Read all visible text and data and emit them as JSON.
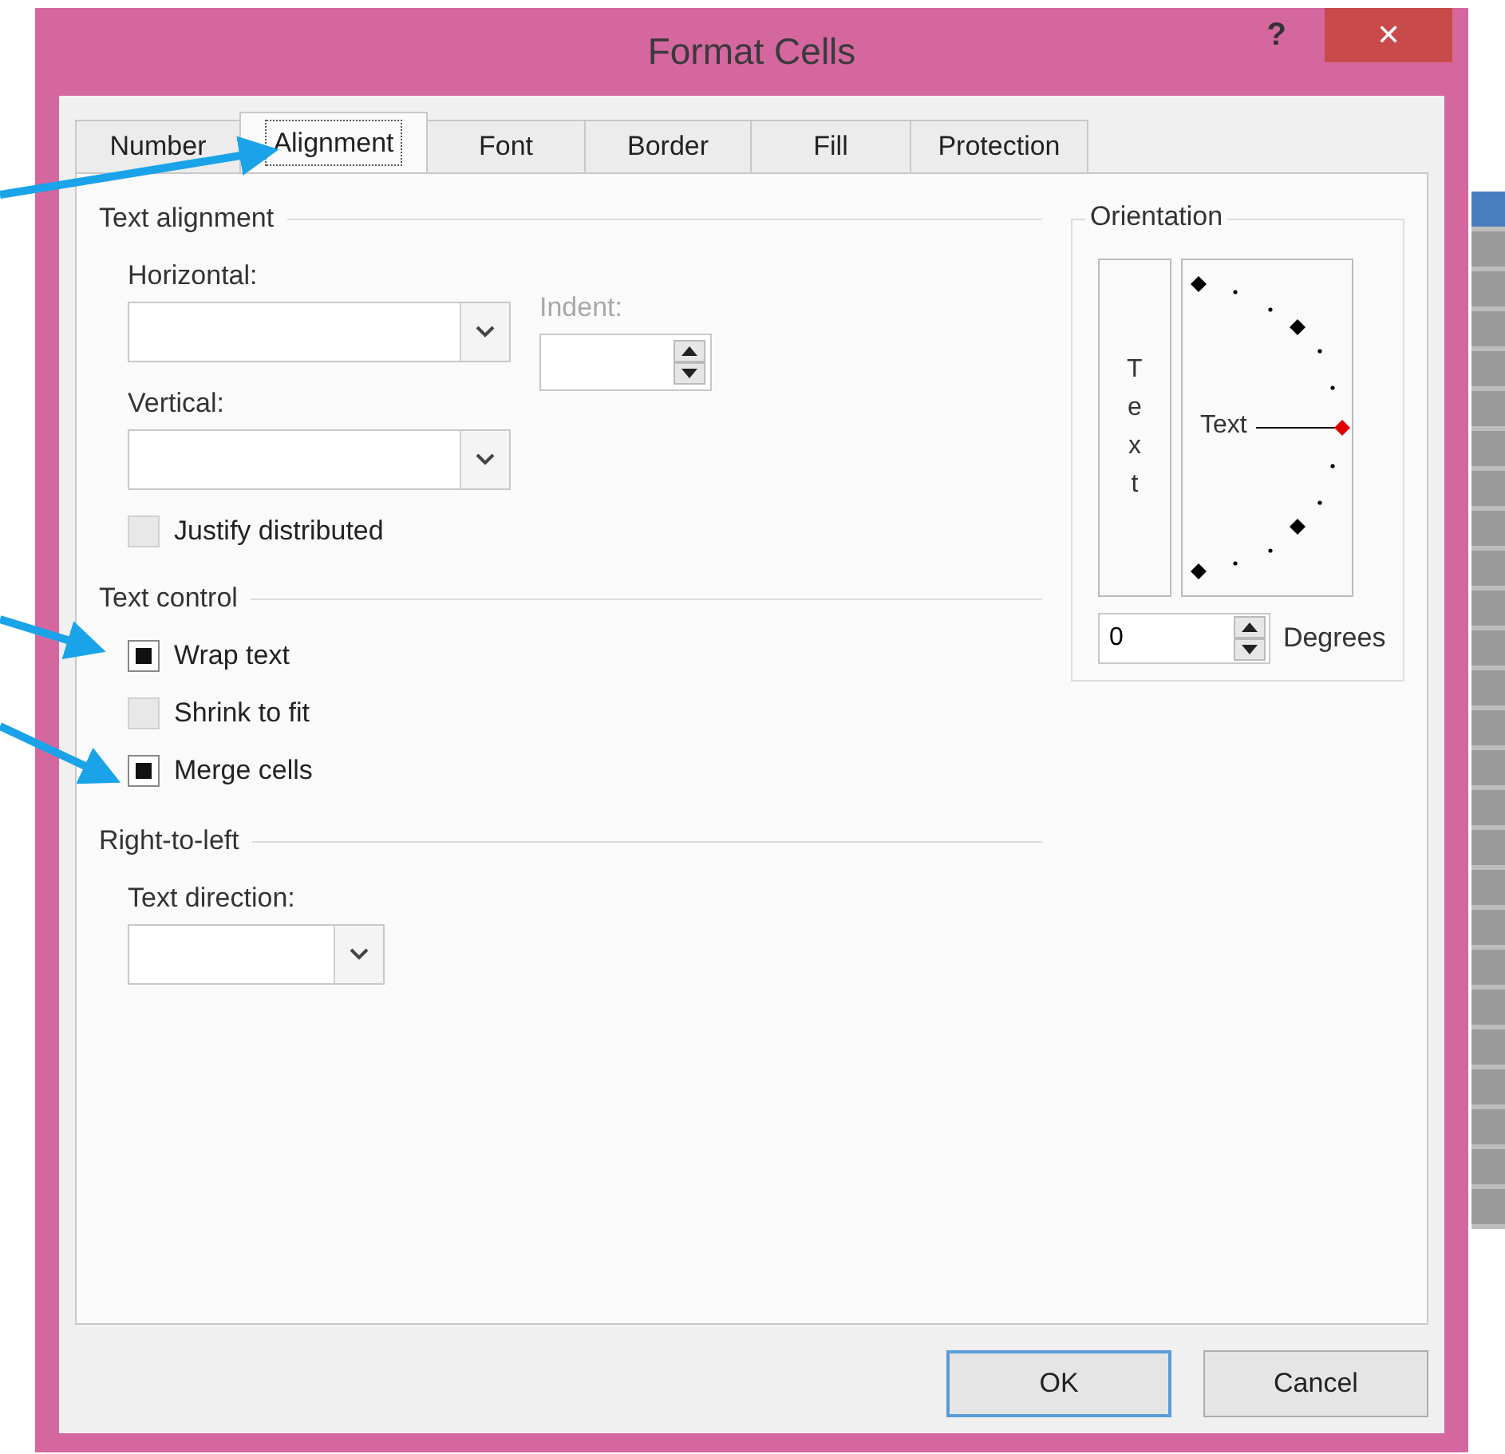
{
  "window": {
    "title": "Format Cells",
    "help": "?",
    "close": "✕"
  },
  "tabs": [
    {
      "label": "Number",
      "selected": false
    },
    {
      "label": "Alignment",
      "selected": true
    },
    {
      "label": "Font",
      "selected": false
    },
    {
      "label": "Border",
      "selected": false
    },
    {
      "label": "Fill",
      "selected": false
    },
    {
      "label": "Protection",
      "selected": false
    }
  ],
  "text_alignment": {
    "title": "Text alignment",
    "horizontal": {
      "label": "Horizontal:"
    },
    "indent": {
      "label": "Indent:",
      "disabled": true
    },
    "vertical": {
      "label": "Vertical:"
    },
    "options": [
      {
        "label": "Justify distributed",
        "checked": false,
        "disabled": true
      }
    ]
  },
  "text_control": {
    "title": "Text control",
    "options": [
      {
        "label": "Wrap text",
        "checked": true,
        "disabled": false
      },
      {
        "label": "Shrink to fit",
        "checked": false,
        "disabled": true
      },
      {
        "label": "Merge cells",
        "checked": true,
        "disabled": false
      }
    ]
  },
  "right_to_left": {
    "title": "Right-to-left",
    "text_direction": {
      "label": "Text direction:"
    }
  },
  "orientation": {
    "title": "Orientation",
    "vertical_text": "Text",
    "dial_text": "Text",
    "degrees": "0",
    "degrees_label": "Degrees"
  },
  "buttons": [
    {
      "label": "OK",
      "default": true
    },
    {
      "label": "Cancel",
      "default": false
    }
  ]
}
